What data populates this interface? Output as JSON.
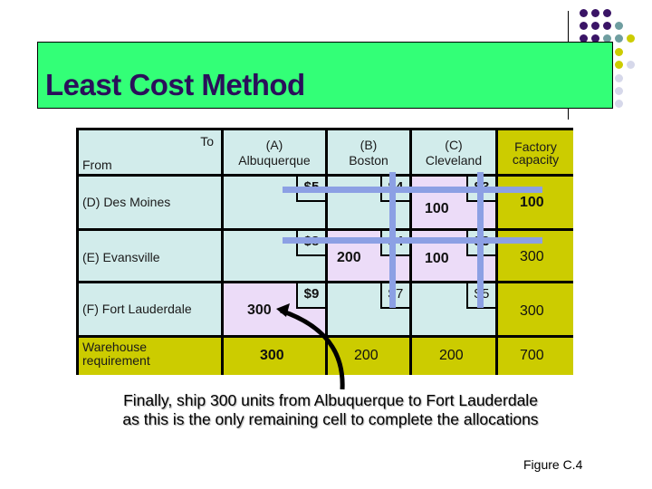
{
  "slide": {
    "title": "Least Cost Method",
    "caption_line1": "Finally, ship 300 units from Albuquerque to Fort Lauderdale",
    "caption_line2": "as this is the only remaining cell to complete the allocations",
    "figure_label": "Figure C.4"
  },
  "decor": {
    "dot_colors": {
      "purple": "#3a1466",
      "teal": "#6f9ea0",
      "olive": "#cccc00",
      "lavender": "#d6d8ea"
    },
    "title_bg": "#33ff77",
    "title_color": "#2a0f5a"
  },
  "table": {
    "corner_to": "To",
    "corner_from": "From",
    "columns": [
      {
        "code": "(A)",
        "name": "Albuquerque"
      },
      {
        "code": "(B)",
        "name": "Boston"
      },
      {
        "code": "(C)",
        "name": "Cleveland"
      }
    ],
    "capacity_header_line1": "Factory",
    "capacity_header_line2": "capacity",
    "rows": [
      {
        "label": "(D) Des Moines",
        "costs": [
          "$5",
          "$4",
          "$3"
        ],
        "allocations": [
          "",
          "",
          "100"
        ],
        "capacity": "100"
      },
      {
        "label": "(E) Evansville",
        "costs": [
          "$8",
          "$4",
          "$3"
        ],
        "allocations": [
          "",
          "200",
          "100"
        ],
        "capacity": "300"
      },
      {
        "label": "(F) Fort Lauderdale",
        "costs": [
          "$9",
          "$7",
          "$5"
        ],
        "allocations": [
          "300",
          "",
          ""
        ],
        "capacity": "300"
      }
    ],
    "requirement_label_line1": "Warehouse",
    "requirement_label_line2": "requirement",
    "requirements": [
      "300",
      "200",
      "200"
    ],
    "total": "700"
  }
}
